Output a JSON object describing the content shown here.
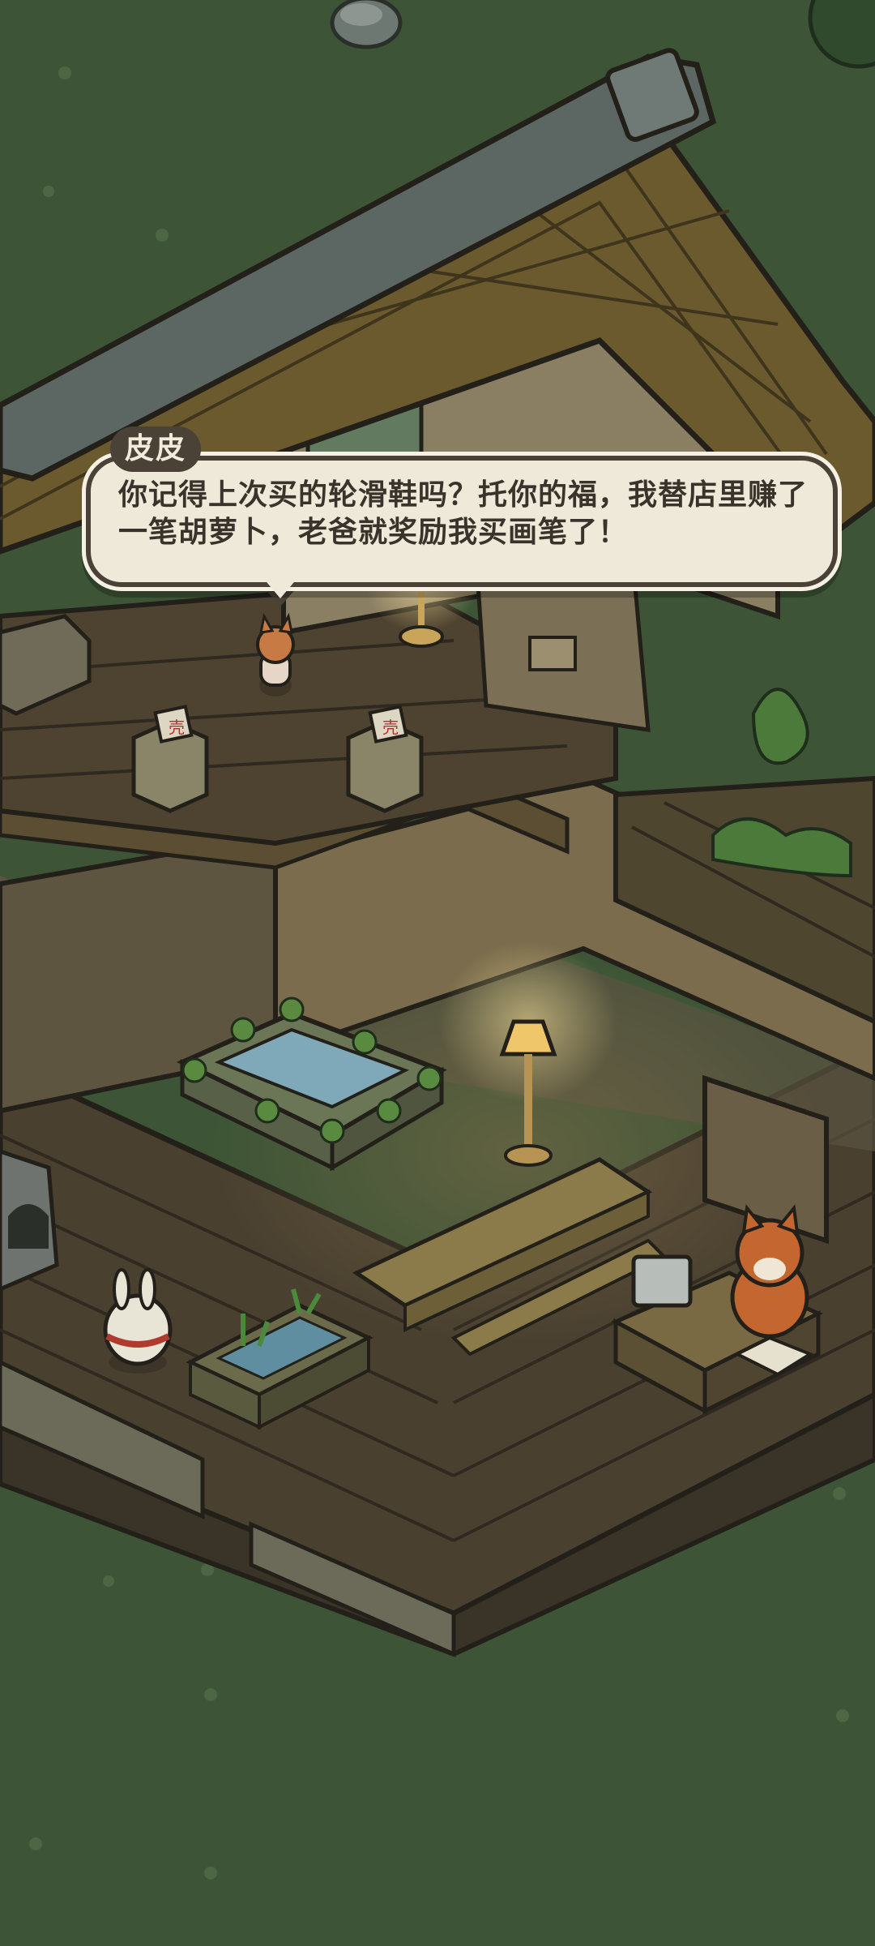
{
  "dialog": {
    "speaker": "皮皮",
    "text": "你记得上次买的轮滑鞋吗？托你的福，我替店里赚了一笔胡萝卜，老爸就奖励我买画笔了！"
  },
  "scene": {
    "sign_label": "壳"
  },
  "colors": {
    "grass": "#3d5536",
    "wood_floor": "#4a3e2d",
    "roof": "#6b5a2e",
    "bubble": "#efe9d9",
    "tag": "#4a4137"
  }
}
